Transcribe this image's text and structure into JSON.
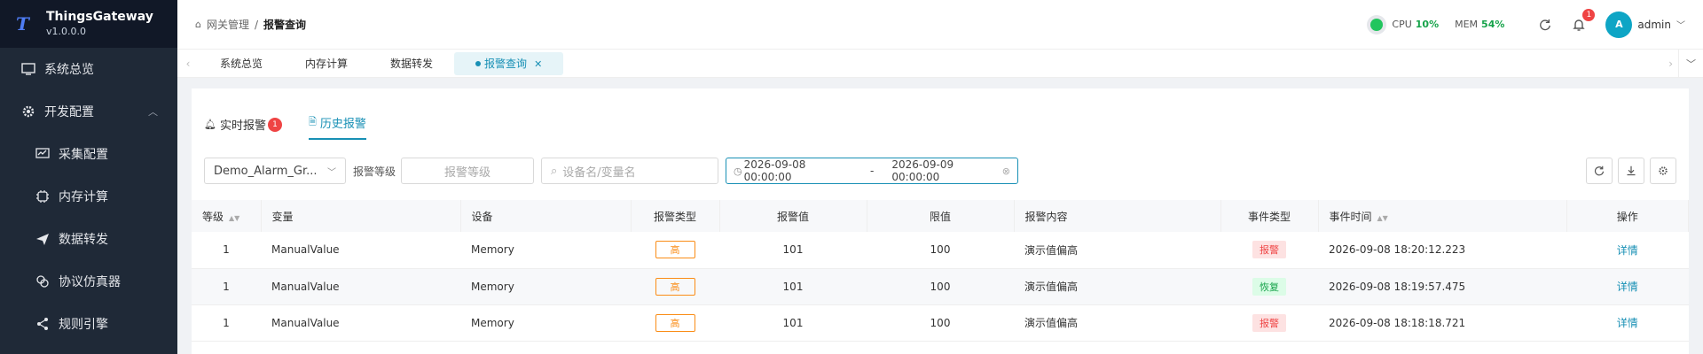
{
  "brand": {
    "name": "ThingsGateway",
    "version": "v1.0.0.0",
    "logo": "T"
  },
  "sidebar": {
    "items": [
      {
        "label": "系统总览",
        "icon": "monitor-icon"
      },
      {
        "label": "开发配置",
        "icon": "gear-icon",
        "expanded": true
      },
      {
        "label": "采集配置",
        "icon": "chart-monitor-icon"
      },
      {
        "label": "内存计算",
        "icon": "chip-icon"
      },
      {
        "label": "数据转发",
        "icon": "send-icon"
      },
      {
        "label": "协议仿真器",
        "icon": "link-icon"
      },
      {
        "label": "规则引擎",
        "icon": "share-icon"
      }
    ]
  },
  "header": {
    "breadcrumb": [
      "网关管理",
      "报警查询"
    ],
    "cpu_label": "CPU",
    "cpu_value": "10%",
    "mem_label": "MEM",
    "mem_value": "54%",
    "notification_count": "1",
    "user_initial": "A",
    "user_name": "admin"
  },
  "tabs": [
    {
      "label": "系统总览"
    },
    {
      "label": "内存计算"
    },
    {
      "label": "数据转发"
    },
    {
      "label": "报警查询",
      "active": true
    }
  ],
  "inner_tabs": {
    "realtime": "实时报警",
    "realtime_count": "1",
    "history": "历史报警"
  },
  "filters": {
    "group_value": "Demo_Alarm_Gr...",
    "level_label": "报警等级",
    "level_placeholder": "报警等级",
    "search_placeholder": "设备名/变量名",
    "date_start": "2026-09-08 00:00:00",
    "date_sep": "-",
    "date_end": "2026-09-09 00:00:00"
  },
  "table": {
    "headers": [
      "等级",
      "变量",
      "设备",
      "报警类型",
      "报警值",
      "限值",
      "报警内容",
      "事件类型",
      "事件时间",
      "操作"
    ],
    "rows": [
      {
        "level": "1",
        "variable": "ManualValue",
        "device": "Memory",
        "alarm_type": "高",
        "value": "101",
        "limit": "100",
        "content": "演示值偏高",
        "event_type": "报警",
        "time": "2026-09-08 18:20:12.223",
        "action": "详情"
      },
      {
        "level": "1",
        "variable": "ManualValue",
        "device": "Memory",
        "alarm_type": "高",
        "value": "101",
        "limit": "100",
        "content": "演示值偏高",
        "event_type": "恢复",
        "time": "2026-09-08 18:19:57.475",
        "action": "详情"
      },
      {
        "level": "1",
        "variable": "ManualValue",
        "device": "Memory",
        "alarm_type": "高",
        "value": "101",
        "limit": "100",
        "content": "演示值偏高",
        "event_type": "报警",
        "time": "2026-09-08 18:18:18.721",
        "action": "详情"
      }
    ]
  },
  "colors": {
    "accent": "#1890b5",
    "sidebar": "#1f2937",
    "alarm": "#ef4444",
    "recover": "#16a34a"
  }
}
